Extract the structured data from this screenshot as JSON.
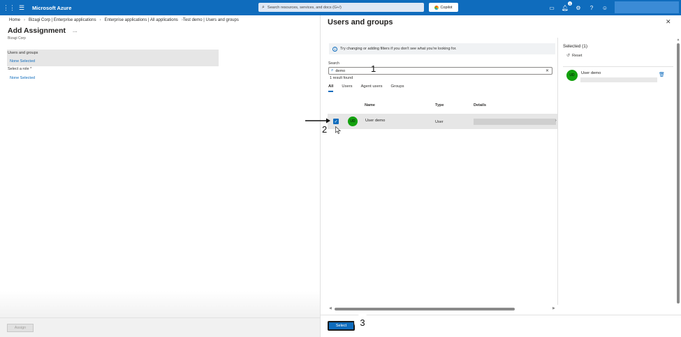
{
  "topbar": {
    "brand": "Microsoft Azure",
    "search_placeholder": "Search resources, services, and docs (G+/)",
    "copilot": "Copilot",
    "notification_count": "1"
  },
  "left": {
    "breadcrumb": [
      "Home",
      "Bizagi Corp | Enterprise applications",
      "Enterprise applications | All applications",
      "Test demo | Users and groups"
    ],
    "title": "Add Assignment",
    "more": "...",
    "subtitle": "Bizagi Corp",
    "users_groups_label": "Users and groups",
    "users_groups_value": "None Selected",
    "role_label": "Select a role *",
    "role_value": "None Selected",
    "assign_button": "Assign"
  },
  "panel": {
    "title": "Users and groups",
    "info": "Try changing or adding filters if you don't see what you're looking for.",
    "search_label": "Search",
    "search_value": "demo",
    "results": "1 result found",
    "tabs": [
      "All",
      "Users",
      "Agent users",
      "Groups"
    ],
    "columns": {
      "name": "Name",
      "type": "Type",
      "details": "Details"
    },
    "rows": [
      {
        "initials": "UD",
        "name": "User demo",
        "type": "User",
        "checked": true
      }
    ],
    "selected_title": "Selected (1)",
    "reset": "Reset",
    "selected_items": [
      {
        "initials": "UD",
        "name": "User demo"
      }
    ],
    "select_button": "Select"
  },
  "annotations": {
    "step1": "1",
    "step2": "2",
    "step3": "3"
  },
  "colors": {
    "accent": "#0f6cbd",
    "avatar": "#13a10e",
    "row_highlight": "#e6e6e6"
  }
}
